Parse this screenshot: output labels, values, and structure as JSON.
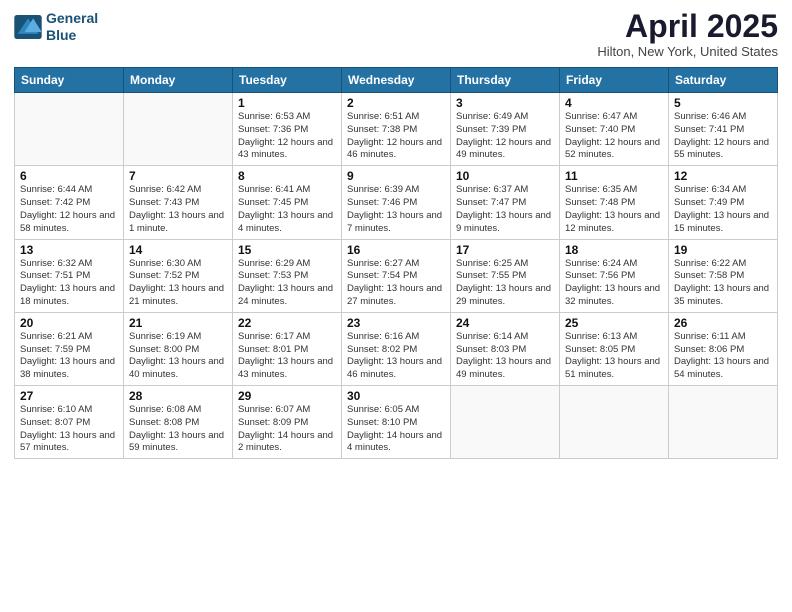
{
  "header": {
    "logo_line1": "General",
    "logo_line2": "Blue",
    "month_title": "April 2025",
    "location": "Hilton, New York, United States"
  },
  "days_of_week": [
    "Sunday",
    "Monday",
    "Tuesday",
    "Wednesday",
    "Thursday",
    "Friday",
    "Saturday"
  ],
  "weeks": [
    [
      {
        "day": "",
        "info": ""
      },
      {
        "day": "",
        "info": ""
      },
      {
        "day": "1",
        "info": "Sunrise: 6:53 AM\nSunset: 7:36 PM\nDaylight: 12 hours and 43 minutes."
      },
      {
        "day": "2",
        "info": "Sunrise: 6:51 AM\nSunset: 7:38 PM\nDaylight: 12 hours and 46 minutes."
      },
      {
        "day": "3",
        "info": "Sunrise: 6:49 AM\nSunset: 7:39 PM\nDaylight: 12 hours and 49 minutes."
      },
      {
        "day": "4",
        "info": "Sunrise: 6:47 AM\nSunset: 7:40 PM\nDaylight: 12 hours and 52 minutes."
      },
      {
        "day": "5",
        "info": "Sunrise: 6:46 AM\nSunset: 7:41 PM\nDaylight: 12 hours and 55 minutes."
      }
    ],
    [
      {
        "day": "6",
        "info": "Sunrise: 6:44 AM\nSunset: 7:42 PM\nDaylight: 12 hours and 58 minutes."
      },
      {
        "day": "7",
        "info": "Sunrise: 6:42 AM\nSunset: 7:43 PM\nDaylight: 13 hours and 1 minute."
      },
      {
        "day": "8",
        "info": "Sunrise: 6:41 AM\nSunset: 7:45 PM\nDaylight: 13 hours and 4 minutes."
      },
      {
        "day": "9",
        "info": "Sunrise: 6:39 AM\nSunset: 7:46 PM\nDaylight: 13 hours and 7 minutes."
      },
      {
        "day": "10",
        "info": "Sunrise: 6:37 AM\nSunset: 7:47 PM\nDaylight: 13 hours and 9 minutes."
      },
      {
        "day": "11",
        "info": "Sunrise: 6:35 AM\nSunset: 7:48 PM\nDaylight: 13 hours and 12 minutes."
      },
      {
        "day": "12",
        "info": "Sunrise: 6:34 AM\nSunset: 7:49 PM\nDaylight: 13 hours and 15 minutes."
      }
    ],
    [
      {
        "day": "13",
        "info": "Sunrise: 6:32 AM\nSunset: 7:51 PM\nDaylight: 13 hours and 18 minutes."
      },
      {
        "day": "14",
        "info": "Sunrise: 6:30 AM\nSunset: 7:52 PM\nDaylight: 13 hours and 21 minutes."
      },
      {
        "day": "15",
        "info": "Sunrise: 6:29 AM\nSunset: 7:53 PM\nDaylight: 13 hours and 24 minutes."
      },
      {
        "day": "16",
        "info": "Sunrise: 6:27 AM\nSunset: 7:54 PM\nDaylight: 13 hours and 27 minutes."
      },
      {
        "day": "17",
        "info": "Sunrise: 6:25 AM\nSunset: 7:55 PM\nDaylight: 13 hours and 29 minutes."
      },
      {
        "day": "18",
        "info": "Sunrise: 6:24 AM\nSunset: 7:56 PM\nDaylight: 13 hours and 32 minutes."
      },
      {
        "day": "19",
        "info": "Sunrise: 6:22 AM\nSunset: 7:58 PM\nDaylight: 13 hours and 35 minutes."
      }
    ],
    [
      {
        "day": "20",
        "info": "Sunrise: 6:21 AM\nSunset: 7:59 PM\nDaylight: 13 hours and 38 minutes."
      },
      {
        "day": "21",
        "info": "Sunrise: 6:19 AM\nSunset: 8:00 PM\nDaylight: 13 hours and 40 minutes."
      },
      {
        "day": "22",
        "info": "Sunrise: 6:17 AM\nSunset: 8:01 PM\nDaylight: 13 hours and 43 minutes."
      },
      {
        "day": "23",
        "info": "Sunrise: 6:16 AM\nSunset: 8:02 PM\nDaylight: 13 hours and 46 minutes."
      },
      {
        "day": "24",
        "info": "Sunrise: 6:14 AM\nSunset: 8:03 PM\nDaylight: 13 hours and 49 minutes."
      },
      {
        "day": "25",
        "info": "Sunrise: 6:13 AM\nSunset: 8:05 PM\nDaylight: 13 hours and 51 minutes."
      },
      {
        "day": "26",
        "info": "Sunrise: 6:11 AM\nSunset: 8:06 PM\nDaylight: 13 hours and 54 minutes."
      }
    ],
    [
      {
        "day": "27",
        "info": "Sunrise: 6:10 AM\nSunset: 8:07 PM\nDaylight: 13 hours and 57 minutes."
      },
      {
        "day": "28",
        "info": "Sunrise: 6:08 AM\nSunset: 8:08 PM\nDaylight: 13 hours and 59 minutes."
      },
      {
        "day": "29",
        "info": "Sunrise: 6:07 AM\nSunset: 8:09 PM\nDaylight: 14 hours and 2 minutes."
      },
      {
        "day": "30",
        "info": "Sunrise: 6:05 AM\nSunset: 8:10 PM\nDaylight: 14 hours and 4 minutes."
      },
      {
        "day": "",
        "info": ""
      },
      {
        "day": "",
        "info": ""
      },
      {
        "day": "",
        "info": ""
      }
    ]
  ]
}
